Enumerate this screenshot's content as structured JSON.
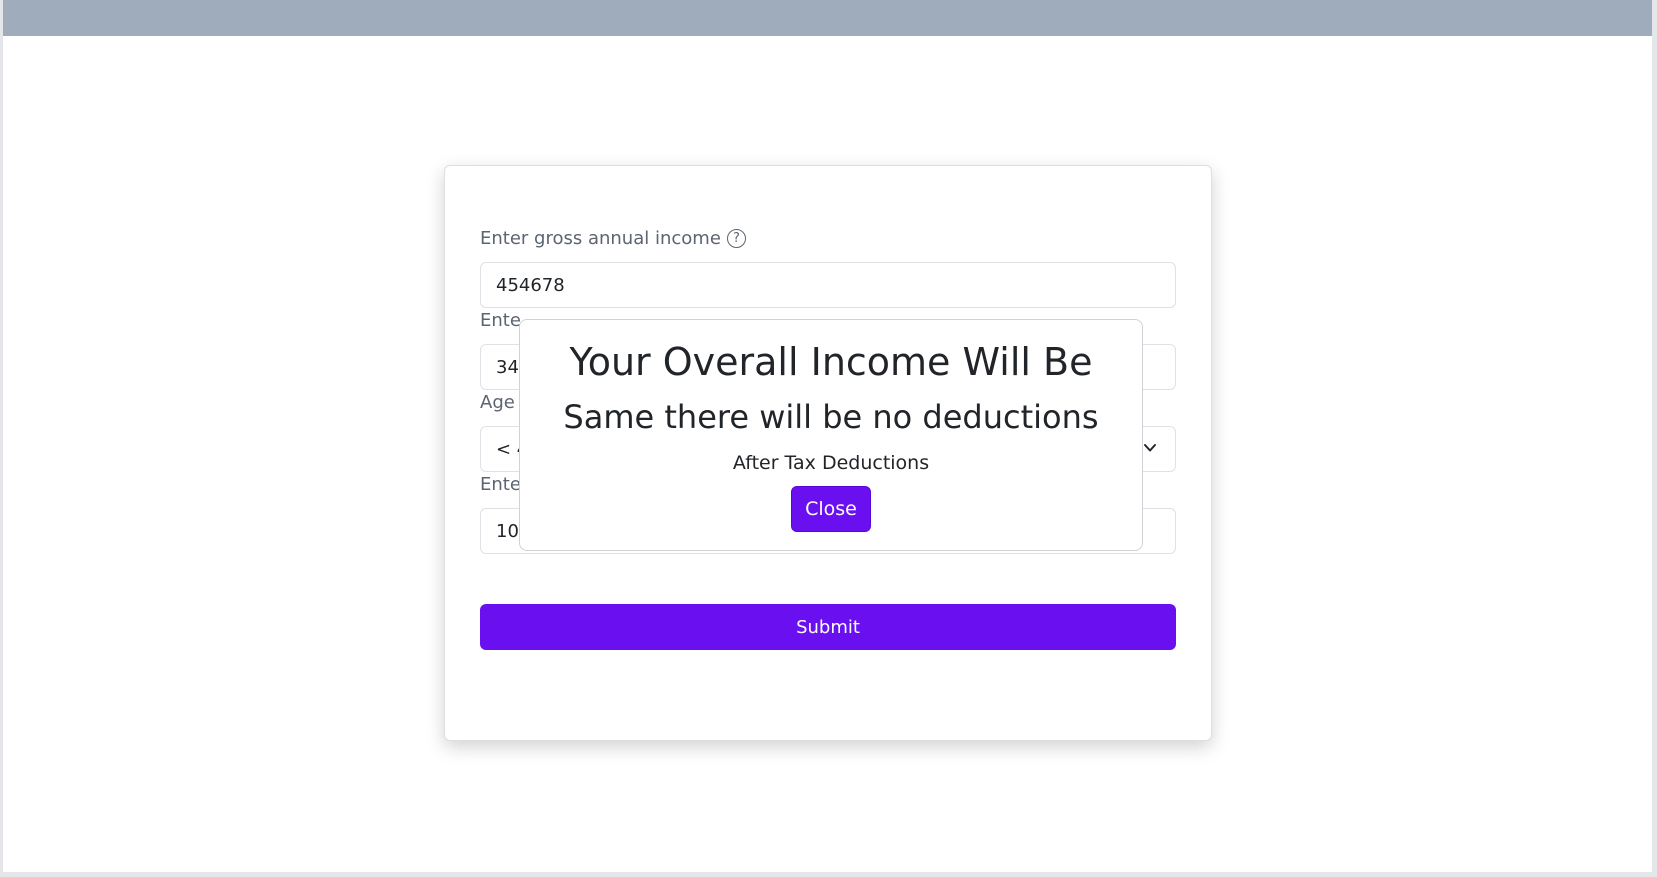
{
  "form": {
    "income_label": "Enter gross annual income",
    "income_value": "454678",
    "field2_label": "Ente",
    "field2_value": "34",
    "age_label": "Age",
    "age_value": "< 4",
    "field4_label": "Ente",
    "field4_value": "100000",
    "submit_label": "Submit"
  },
  "modal": {
    "title": "Your Overall Income Will Be",
    "subtitle": "Same there will be no deductions",
    "caption": "After Tax Deductions",
    "close_label": "Close"
  },
  "colors": {
    "accent": "#6a10f0",
    "topbar": "#9eacbb"
  },
  "icons": {
    "help": "question-circle-icon",
    "select": "chevron-down-icon"
  }
}
